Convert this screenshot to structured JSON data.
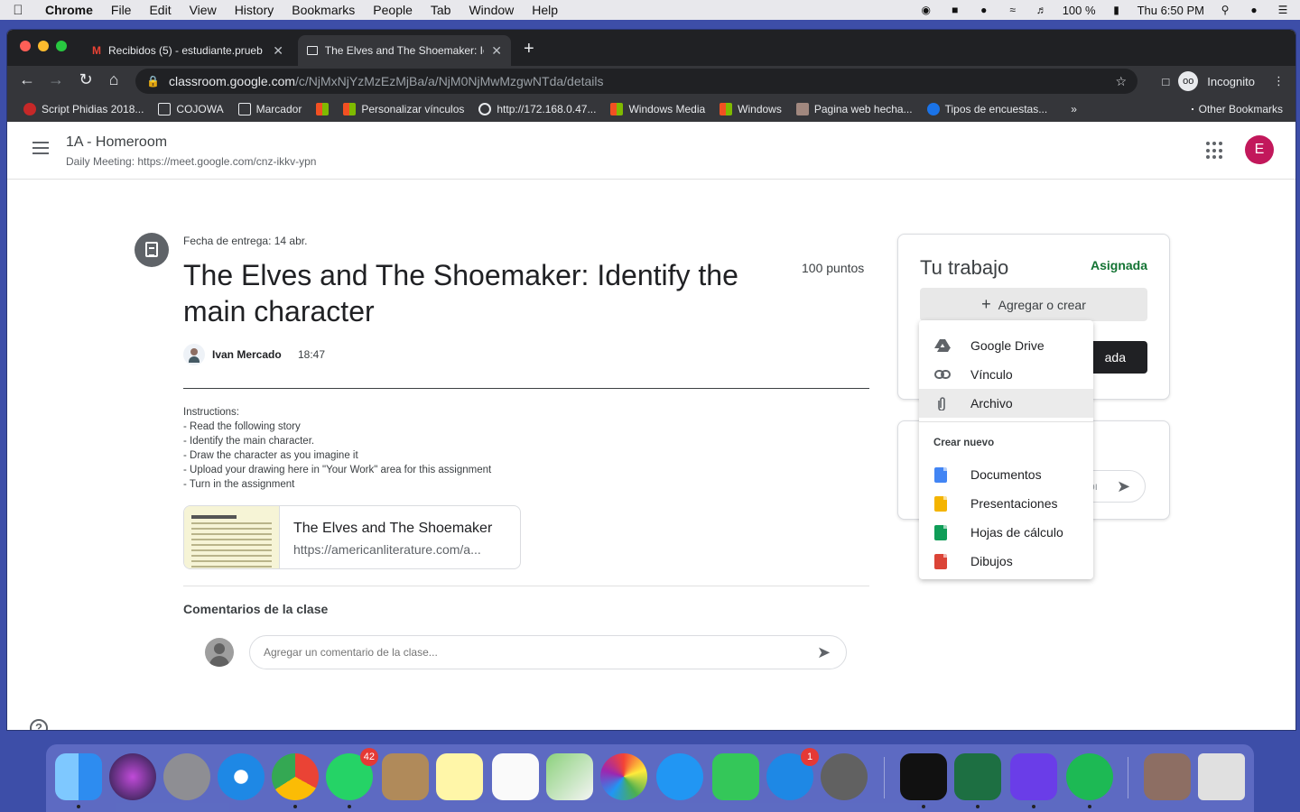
{
  "menubar": {
    "app": "Chrome",
    "items": [
      "File",
      "Edit",
      "View",
      "History",
      "Bookmarks",
      "People",
      "Tab",
      "Window",
      "Help"
    ],
    "battery": "100 %",
    "clock": "Thu 6:50 PM"
  },
  "browser": {
    "tabs": [
      {
        "title": "Recibidos (5) - estudiante.prueb",
        "icon": "gmail-icon"
      },
      {
        "title": "The Elves and The Shoemaker: Ic",
        "icon": "classroom-icon"
      }
    ],
    "url_host": "classroom.google.com",
    "url_path": "/c/NjMxNjYzMzEzMjBa/a/NjM0NjMwMzgwNTda/details",
    "profile_label": "Incognito",
    "bookmarks": [
      {
        "label": "Script Phidias 2018...",
        "icon": "phidias-icon",
        "color": "#c62828"
      },
      {
        "label": "COJOWA",
        "icon": "folder-icon",
        "color": "#e8eaed"
      },
      {
        "label": "Marcador",
        "icon": "folder-icon",
        "color": "#e8eaed"
      },
      {
        "label": "",
        "icon": "windows-icon",
        "color": "#f25022"
      },
      {
        "label": "Personalizar vínculos",
        "icon": "windows-icon",
        "color": "#f25022"
      },
      {
        "label": "http://172.168.0.47...",
        "icon": "globe-icon",
        "color": "#e8eaed"
      },
      {
        "label": "Windows Media",
        "icon": "windows-icon",
        "color": "#f25022"
      },
      {
        "label": "Windows",
        "icon": "windows-icon",
        "color": "#f25022"
      },
      {
        "label": "Pagina web hecha...",
        "icon": "page-icon",
        "color": "#a1887f"
      },
      {
        "label": "Tipos de encuestas...",
        "icon": "survey-icon",
        "color": "#1a73e8"
      }
    ],
    "bookmarks_more": "»",
    "other_bookmarks": "Other Bookmarks"
  },
  "classroom": {
    "class_name": "1A - Homeroom",
    "class_subtitle": "Daily Meeting: https://meet.google.com/cnz-ikkv-ypn",
    "user_initial": "E"
  },
  "assignment": {
    "due": "Fecha de entrega: 14 abr.",
    "title": "The Elves and The Shoemaker: Identify the main character",
    "points": "100 puntos",
    "author": "Ivan Mercado",
    "time": "18:47",
    "instructions": [
      "Instructions:",
      "- Read the following story",
      "- Identify the main character.",
      "- Draw the character as you imagine it",
      "- Upload your drawing here in \"Your Work\" area for this assignment",
      "- Turn in the assignment"
    ],
    "attachment": {
      "title": "The Elves and The Shoemaker",
      "url": "https://americanliterature.com/a..."
    },
    "comments_title": "Comentarios de la clase",
    "comment_placeholder": "Agregar un comentario de la clase..."
  },
  "your_work": {
    "title": "Tu trabajo",
    "status": "Asignada",
    "add_button": "Agregar o crear",
    "submit_button_partial": "ada",
    "private_input_partial": "o pı"
  },
  "add_menu": {
    "items": [
      {
        "label": "Google Drive",
        "icon": "drive-icon"
      },
      {
        "label": "Vínculo",
        "icon": "link-icon"
      },
      {
        "label": "Archivo",
        "icon": "paperclip-icon"
      }
    ],
    "section": "Crear nuevo",
    "create_items": [
      {
        "label": "Documentos",
        "icon": "docs-icon",
        "color": "#4285f4"
      },
      {
        "label": "Presentaciones",
        "icon": "slides-icon",
        "color": "#f4b400"
      },
      {
        "label": "Hojas de cálculo",
        "icon": "sheets-icon",
        "color": "#0f9d58"
      },
      {
        "label": "Dibujos",
        "icon": "drawings-icon",
        "color": "#db4437"
      }
    ]
  },
  "dock": {
    "whatsapp_badge": "42",
    "appstore_badge": "1"
  }
}
